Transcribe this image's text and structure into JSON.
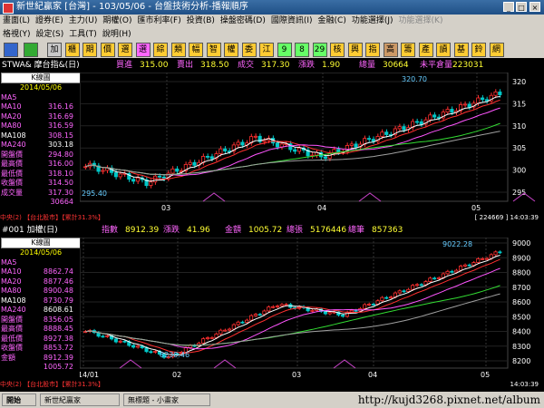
{
  "window": {
    "title": "新世紀贏家 [台灣] - 103/05/06 - 台盤技術分析-播報順序",
    "min": "_",
    "max": "□",
    "close": "×"
  },
  "menu_row1": [
    "畫面(L)",
    "證券(E)",
    "主力(U)",
    "期權(O)",
    "匯市利率(F)",
    "投資(B)",
    "操盤密碼(D)",
    "國際資訊(I)",
    "金融(C)",
    "功能選擇(J)",
    "功能選擇(K)"
  ],
  "menu_row2": [
    "格視(Y)",
    "設定(S)",
    "工具(T)",
    "說明(H)"
  ],
  "toolbar": [
    "加",
    "櫃",
    "期",
    "價",
    "選",
    "選",
    "綜",
    "類",
    "幅",
    "智",
    "權",
    "委",
    "江",
    "9",
    "8",
    "29",
    "核",
    "興",
    "指",
    "高",
    "籌",
    "產",
    "讀",
    "基",
    "鈴",
    "網"
  ],
  "colors": {
    "ma5": "#ffffff",
    "ma10": "#ff3030",
    "ma20": "#ff55ff",
    "ma80": "#33dd33",
    "ma108": "#a0a0a0",
    "ma240": "#3399ff",
    "up": "#ff3030",
    "down": "#00c8c8",
    "hdr_label": "#ff66ff",
    "value": "#ffff33"
  },
  "panel1": {
    "symbol": "STWA& 摩台指&(日)",
    "fields": [
      {
        "label": "買進",
        "value": "315.00"
      },
      {
        "label": "賣出",
        "value": "318.50"
      },
      {
        "label": "成交",
        "value": "317.30"
      },
      {
        "label": "漲跌",
        "value": "1.90"
      },
      {
        "label": "總量",
        "value": "30664"
      },
      {
        "label": "未平倉量",
        "value": "223031"
      }
    ],
    "legend_head": "K線圖",
    "legend_date": "2014/05/06",
    "legend": [
      {
        "label": "MA5",
        "value": "316.16",
        "color": "#ff66ff"
      },
      {
        "label": "MA10",
        "value": "316.69",
        "color": "#ff66ff"
      },
      {
        "label": "MA20",
        "value": "316.59",
        "color": "#ff66ff"
      },
      {
        "label": "MA80",
        "value": "308.15",
        "color": "#ff66ff"
      },
      {
        "label": "MA108",
        "value": "303.18",
        "color": "#ffffff"
      },
      {
        "label": "MA240",
        "value": "294.80",
        "color": "#ff66ff"
      },
      {
        "label": "開盤價",
        "value": "316.00",
        "color": "#ff66ff"
      },
      {
        "label": "最高價",
        "value": "318.10",
        "color": "#ff66ff"
      },
      {
        "label": "最低價",
        "value": "314.50",
        "color": "#ff66ff"
      },
      {
        "label": "收盤價",
        "value": "317.30",
        "color": "#ff66ff"
      },
      {
        "label": "成交量",
        "value": "30664",
        "color": "#ff66ff"
      }
    ],
    "y_ticks": [
      "320",
      "315",
      "310",
      "305",
      "300",
      "295"
    ],
    "x_ticks": [
      "03",
      "04",
      "05"
    ],
    "hi_label": "320.70",
    "lo_label": "295.40",
    "status": "中央(2) 【台北股市】【累計31.3%】",
    "status_right": "[ 224669 ] 14:03:39"
  },
  "panel2": {
    "symbol": "#001 加權(日)",
    "fields": [
      {
        "label": "指數",
        "value": "8912.39"
      },
      {
        "label": "漲跌",
        "value": "41.96"
      },
      {
        "label": "金額",
        "value": "1005.72"
      },
      {
        "label": "總張",
        "value": "5176446"
      },
      {
        "label": "總筆",
        "value": "857363"
      }
    ],
    "legend_head": "K線圖",
    "legend_date": "2014/05/06",
    "legend": [
      {
        "label": "MA5",
        "value": "8862.74",
        "color": "#ff66ff"
      },
      {
        "label": "MA10",
        "value": "8877.46",
        "color": "#ff66ff"
      },
      {
        "label": "MA20",
        "value": "8900.48",
        "color": "#ff66ff"
      },
      {
        "label": "MA80",
        "value": "8730.79",
        "color": "#ff66ff"
      },
      {
        "label": "MA108",
        "value": "8608.61",
        "color": "#ffffff"
      },
      {
        "label": "MA240",
        "value": "8356.05",
        "color": "#ff66ff"
      },
      {
        "label": "開盤價",
        "value": "8888.45",
        "color": "#ff66ff"
      },
      {
        "label": "最高價",
        "value": "8927.38",
        "color": "#ff66ff"
      },
      {
        "label": "最低價",
        "value": "8853.72",
        "color": "#ff66ff"
      },
      {
        "label": "收盤價",
        "value": "8912.39",
        "color": "#ff66ff"
      },
      {
        "label": "金額",
        "value": "1005.72",
        "color": "#ff66ff"
      }
    ],
    "y_ticks": [
      "9000",
      "8900",
      "8800",
      "8700",
      "8600",
      "8500",
      "8400",
      "8300",
      "8200"
    ],
    "x_ticks": [
      "14/01",
      "02",
      "03",
      "04",
      "05"
    ],
    "hi_label": "9022.28",
    "lo_label": "8230.46",
    "status": "中央(2) 【台北股市】【累計31.3%】",
    "status_right": "14:03:39"
  },
  "taskbar": {
    "start": "開始",
    "items": [
      "新世紀贏家",
      "無標題 - 小畫家"
    ],
    "url": "http://kujd3268.pixnet.net/album"
  }
}
